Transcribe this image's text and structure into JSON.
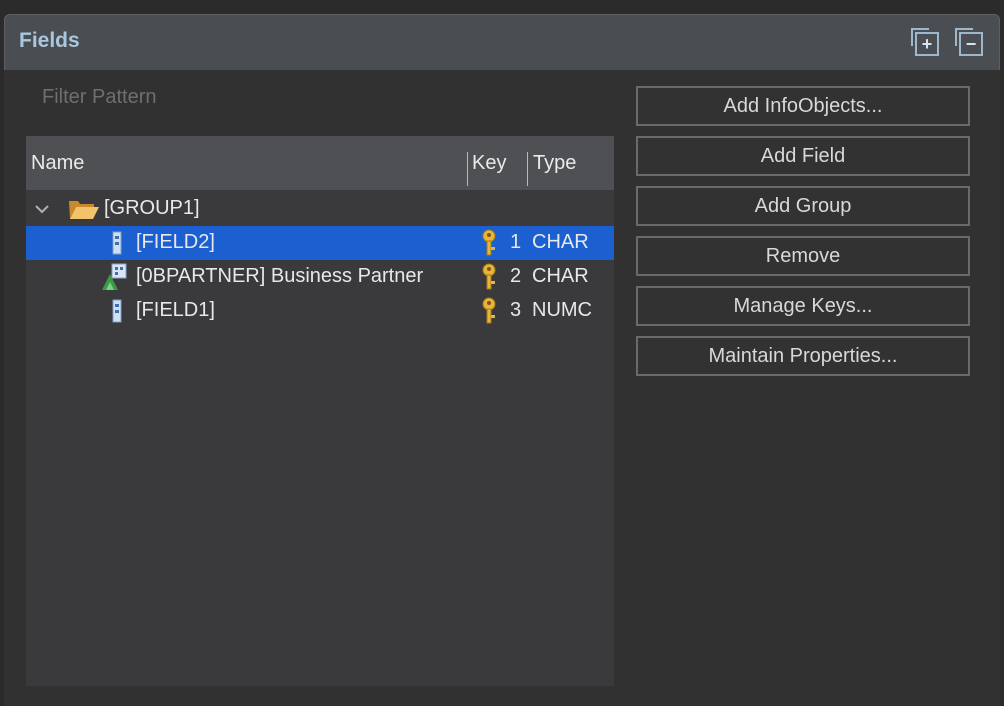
{
  "section": {
    "title": "Fields",
    "expand_icon": "expand-all-icon",
    "collapse_icon": "collapse-all-icon"
  },
  "filter": {
    "placeholder": "Filter Pattern",
    "value": ""
  },
  "tree": {
    "columns": {
      "name": "Name",
      "key": "Key",
      "type": "Type"
    },
    "group": {
      "label": "[GROUP1]",
      "expanded": true,
      "icon": "open-folder-icon"
    },
    "rows": [
      {
        "name": "[FIELD2]",
        "key": "1",
        "type": "CHAR",
        "icon": "field-icon",
        "selected": true
      },
      {
        "name": "[0BPARTNER] Business Partner",
        "key": "2",
        "type": "CHAR",
        "icon": "infoobject-icon",
        "selected": false
      },
      {
        "name": "[FIELD1]",
        "key": "3",
        "type": "NUMC",
        "icon": "field-icon",
        "selected": false
      }
    ],
    "key_icon": "key-icon"
  },
  "buttons": {
    "add_infoobjects": "Add InfoObjects...",
    "add_field": "Add Field",
    "add_group": "Add Group",
    "remove": "Remove",
    "manage_keys": "Manage Keys...",
    "maintain_properties": "Maintain Properties..."
  },
  "colors": {
    "selection": "#1b5fd1",
    "title": "#a9c7de",
    "key_gold": "#e8b53a"
  }
}
